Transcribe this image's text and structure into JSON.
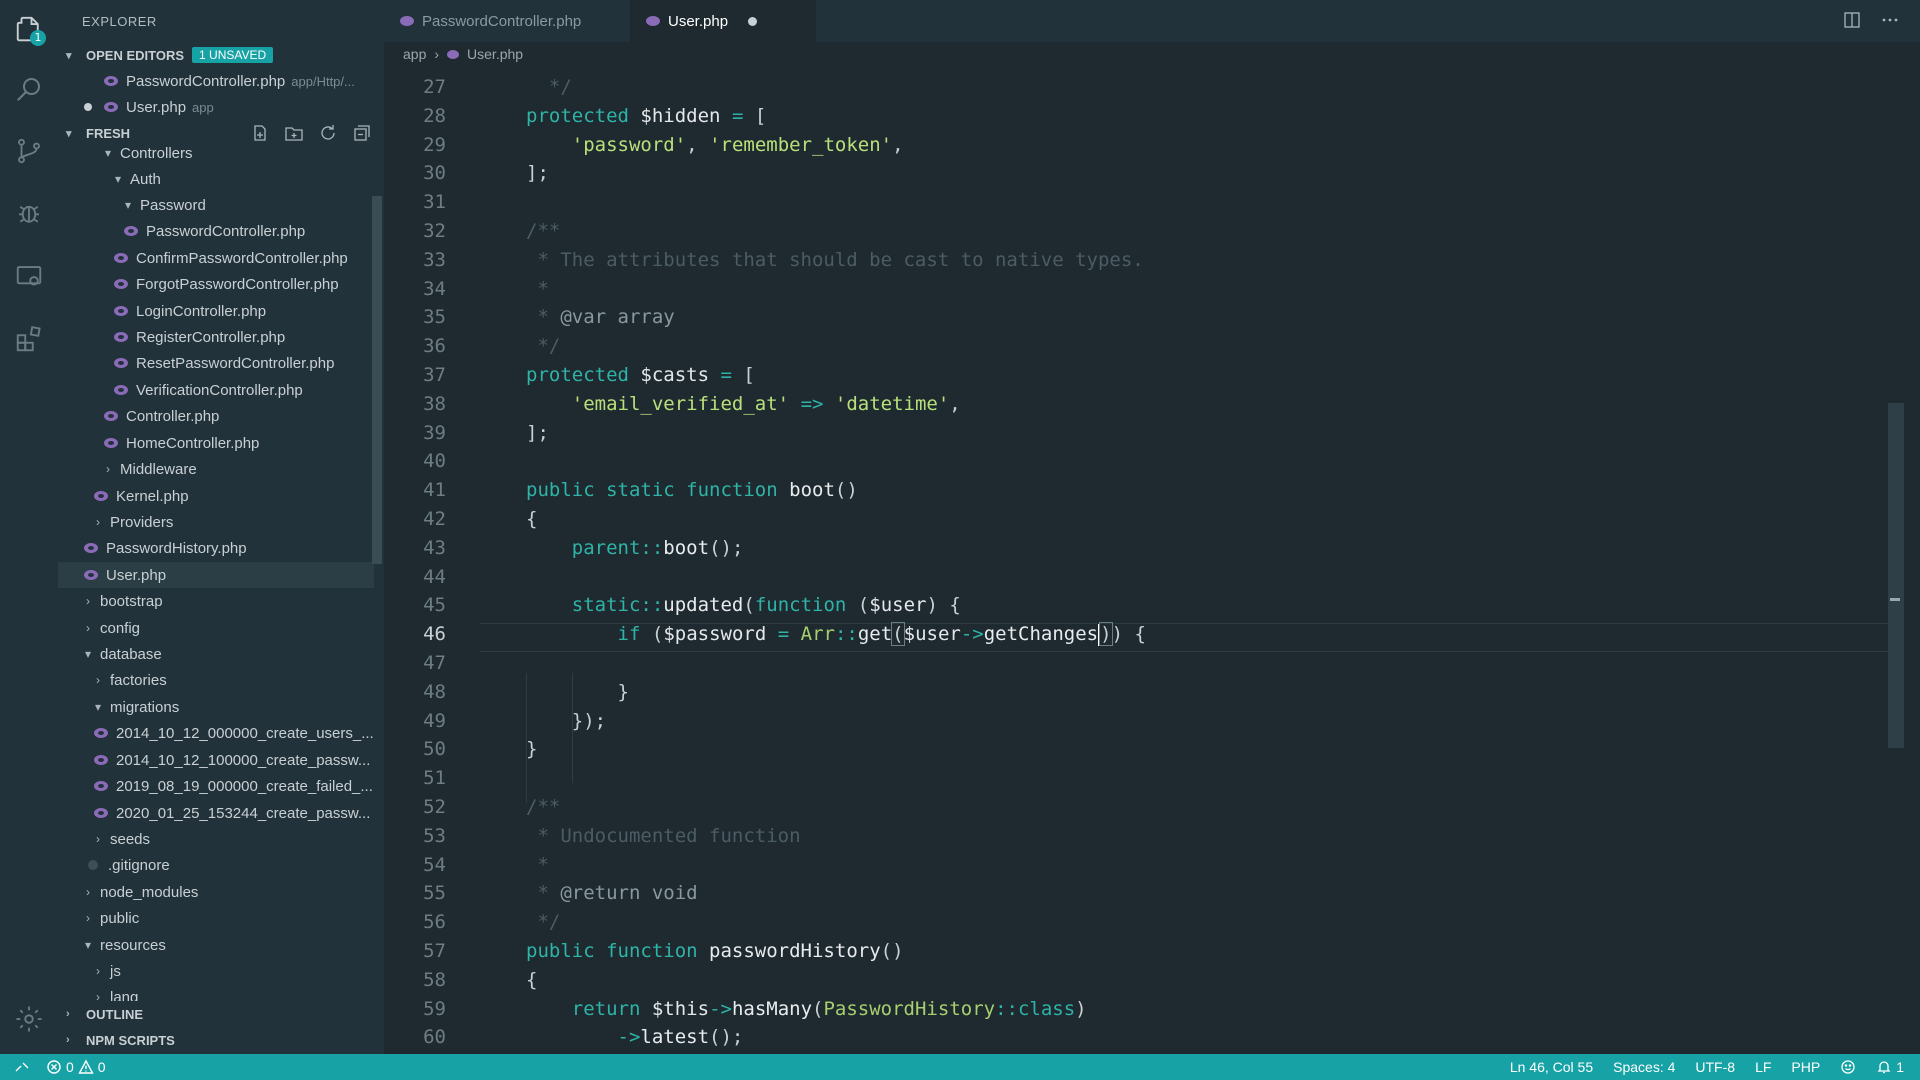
{
  "sidebar": {
    "title": "EXPLORER",
    "open_editors": {
      "label": "OPEN EDITORS",
      "badge": "1 UNSAVED",
      "items": [
        {
          "name": "PasswordController.php",
          "path": "app/Http/..."
        },
        {
          "name": "User.php",
          "path": "app"
        }
      ]
    },
    "project": {
      "label": "FRESH",
      "tree": [
        {
          "label": "Controllers"
        },
        {
          "label": "Auth"
        },
        {
          "label": "Password"
        },
        {
          "label": "PasswordController.php"
        },
        {
          "label": "ConfirmPasswordController.php"
        },
        {
          "label": "ForgotPasswordController.php"
        },
        {
          "label": "LoginController.php"
        },
        {
          "label": "RegisterController.php"
        },
        {
          "label": "ResetPasswordController.php"
        },
        {
          "label": "VerificationController.php"
        },
        {
          "label": "Controller.php"
        },
        {
          "label": "HomeController.php"
        },
        {
          "label": "Middleware"
        },
        {
          "label": "Kernel.php"
        },
        {
          "label": "Providers"
        },
        {
          "label": "PasswordHistory.php"
        },
        {
          "label": "User.php"
        },
        {
          "label": "bootstrap"
        },
        {
          "label": "config"
        },
        {
          "label": "database"
        },
        {
          "label": "factories"
        },
        {
          "label": "migrations"
        },
        {
          "label": "2014_10_12_000000_create_users_..."
        },
        {
          "label": "2014_10_12_100000_create_passw..."
        },
        {
          "label": "2019_08_19_000000_create_failed_..."
        },
        {
          "label": "2020_01_25_153244_create_passw..."
        },
        {
          "label": "seeds"
        },
        {
          "label": ".gitignore"
        },
        {
          "label": "node_modules"
        },
        {
          "label": "public"
        },
        {
          "label": "resources"
        },
        {
          "label": "js"
        },
        {
          "label": "lang"
        }
      ]
    },
    "outline_label": "OUTLINE",
    "npm_label": "NPM SCRIPTS"
  },
  "activity_badge": "1",
  "tabs": [
    {
      "label": "PasswordController.php"
    },
    {
      "label": "User.php"
    }
  ],
  "breadcrumb": {
    "folder": "app",
    "file": "User.php"
  },
  "editor": {
    "line_numbers": [
      "27",
      "28",
      "29",
      "30",
      "31",
      "32",
      "33",
      "34",
      "35",
      "36",
      "37",
      "38",
      "39",
      "40",
      "41",
      "42",
      "43",
      "44",
      "45",
      "46",
      "47",
      "48",
      "49",
      "50",
      "51",
      "52",
      "53",
      "54",
      "55",
      "56",
      "57",
      "58",
      "59",
      "60"
    ]
  },
  "status": {
    "errors": "0",
    "warnings": "0",
    "position": "Ln 46, Col 55",
    "spaces": "Spaces: 4",
    "encoding": "UTF-8",
    "eol": "LF",
    "language": "PHP",
    "notifications": "1"
  }
}
